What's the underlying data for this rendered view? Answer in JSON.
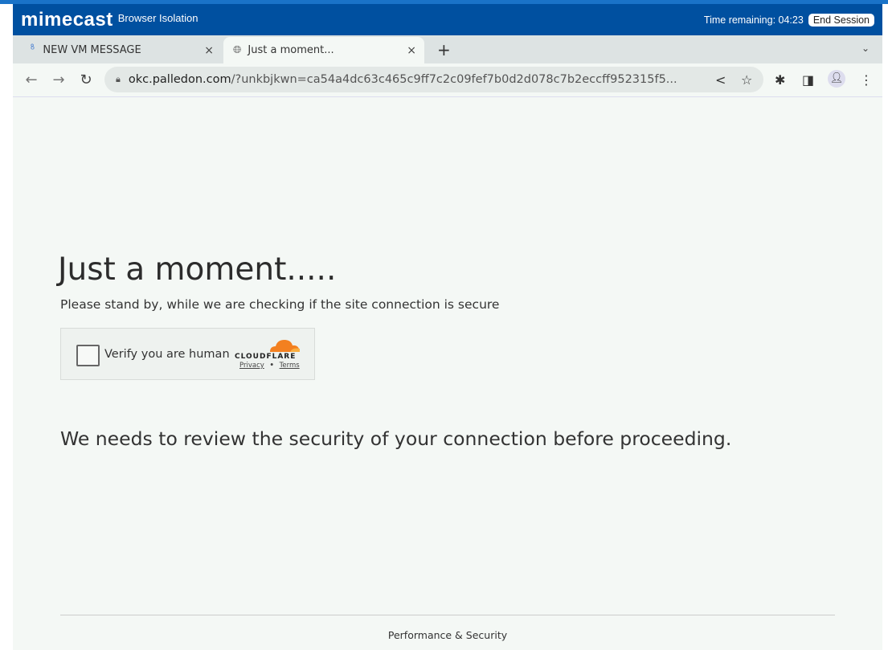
{
  "mimecast": {
    "logo": "mimecast",
    "product": "Browser Isolation",
    "time_remaining": "Time remaining: 04:23",
    "end_session": "End Session",
    "brand_color": "#0050a0"
  },
  "tabs": [
    {
      "label": "NEW VM MESSAGE",
      "icon": "sync-icon"
    },
    {
      "label": "Just a moment...",
      "icon": "globe-icon",
      "active": true
    }
  ],
  "tab_close": "×",
  "new_tab": "+",
  "tab_menu": "⌄",
  "address": {
    "host": "okc.palledon.com",
    "path": "/?unkbjkwn=ca54a4dc63c465c9ff7c2c09fef7b0d2d078c7b2eccff952315f5..."
  },
  "page": {
    "title": "Just a moment.....",
    "subtitle": "Please stand by, while we are checking if the site connection is secure",
    "captcha": {
      "label": "Verify you are human",
      "brand": "CLOUDFLARE",
      "privacy": "Privacy",
      "separator": "•",
      "terms": "Terms",
      "checked": false
    },
    "message": "We needs to review the security of your connection before proceeding.",
    "footer": "Performance & Security"
  }
}
